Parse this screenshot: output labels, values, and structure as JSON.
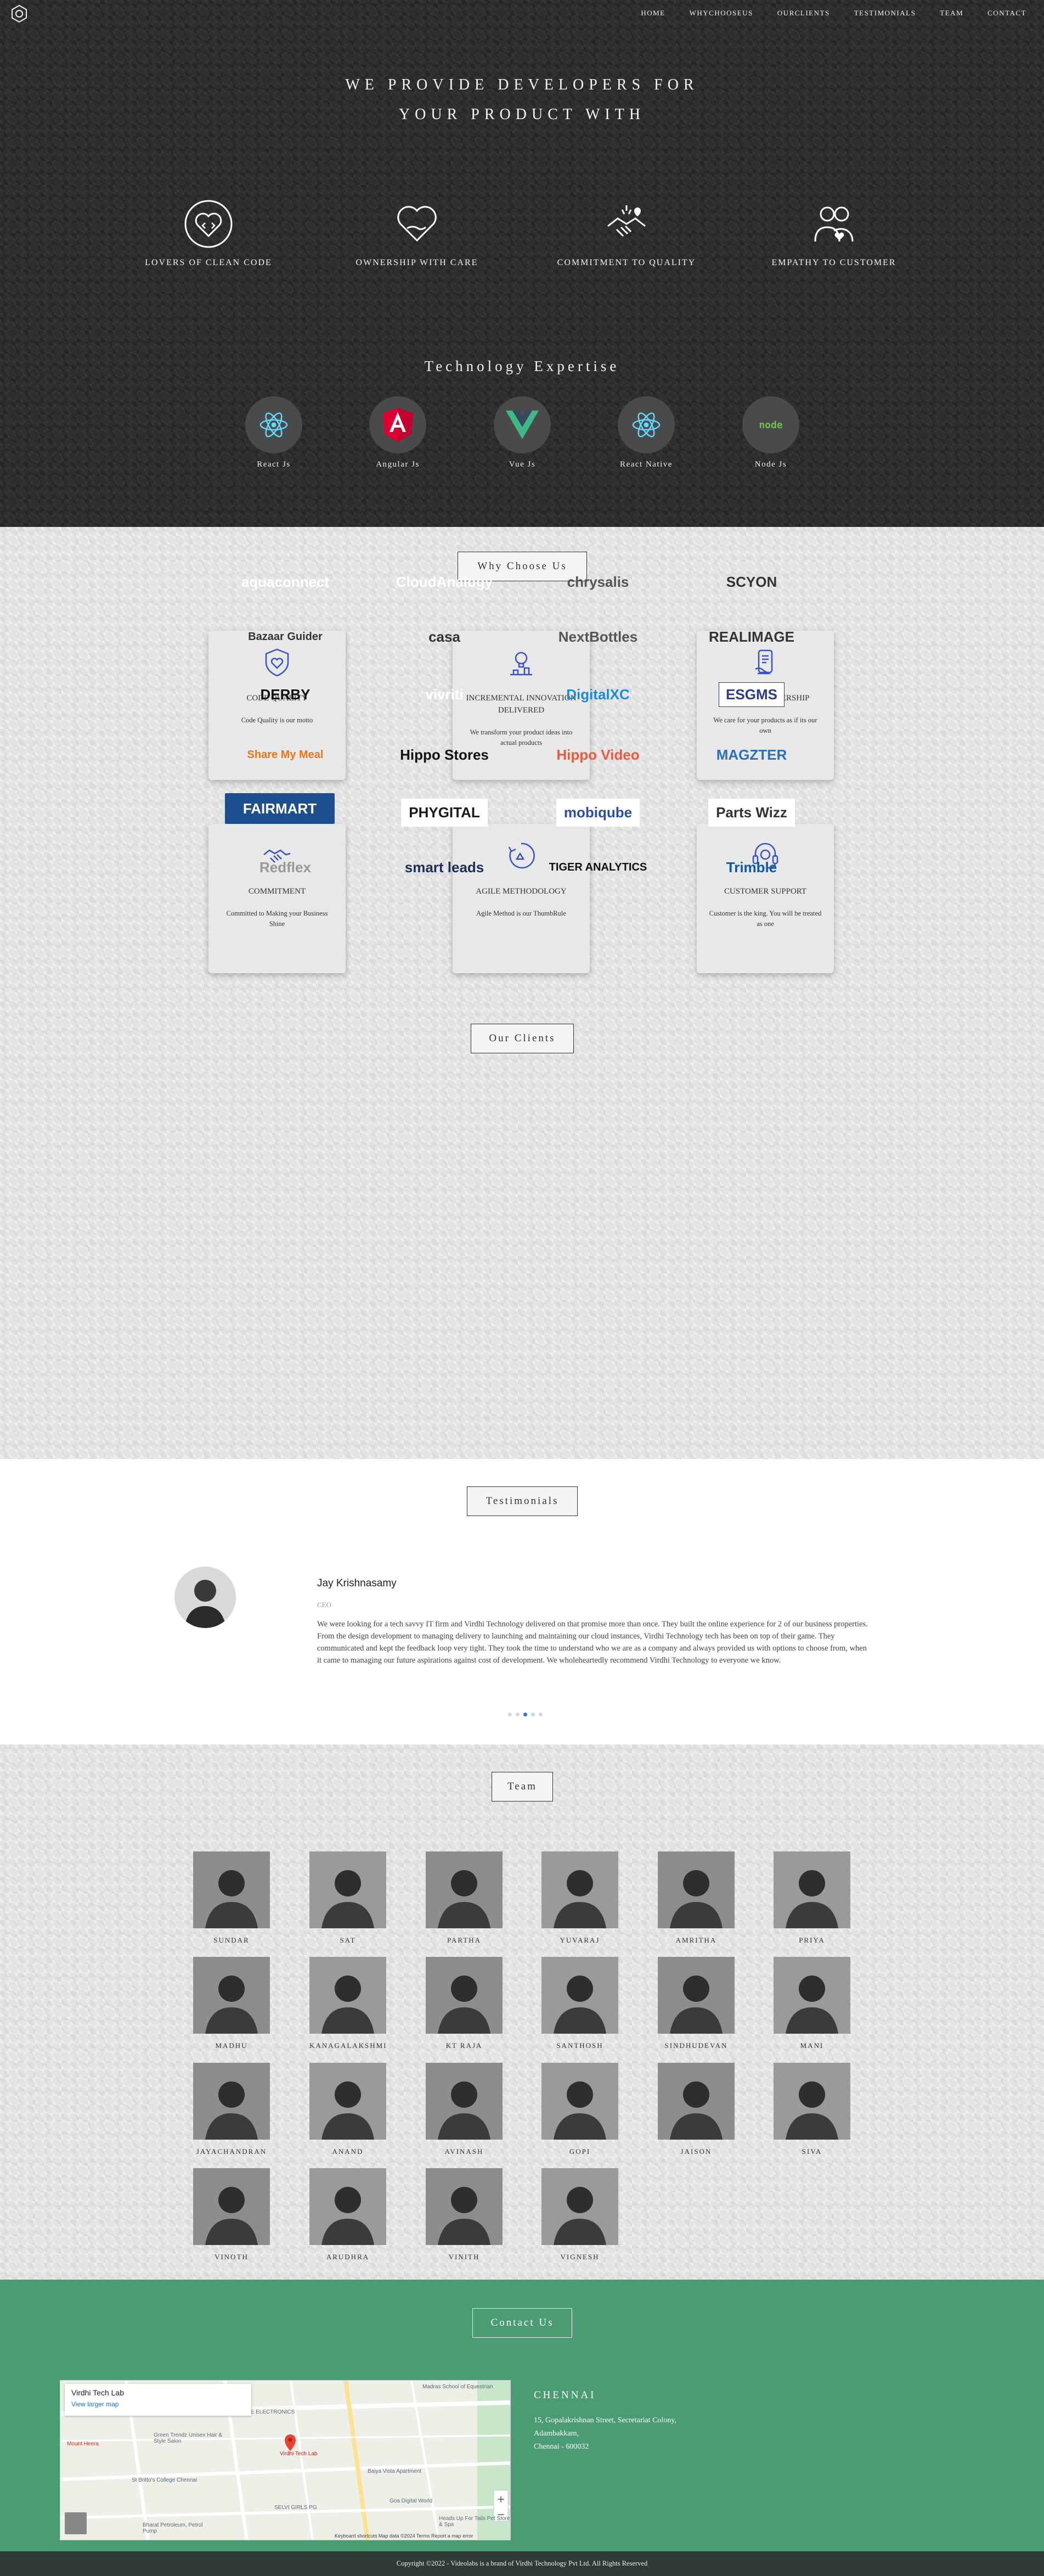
{
  "nav": {
    "items": [
      "HOME",
      "WHYCHOOSEUS",
      "OURCLIENTS",
      "TESTIMONIALS",
      "TEAM",
      "CONTACT"
    ]
  },
  "hero": {
    "title_line1": "WE PROVIDE DEVELOPERS FOR",
    "title_line2": "YOUR PRODUCT WITH",
    "values": [
      {
        "label": "LOVERS OF CLEAN CODE",
        "icon": "heart-code-icon"
      },
      {
        "label": "OWNERSHIP WITH CARE",
        "icon": "heart-hand-icon"
      },
      {
        "label": "COMMITMENT TO QUALITY",
        "icon": "handshake-icon"
      },
      {
        "label": "EMPATHY TO CUSTOMER",
        "icon": "people-heart-icon"
      }
    ],
    "tech_title": "Technology Expertise",
    "tech": [
      {
        "label": "React Js",
        "icon": "react-icon"
      },
      {
        "label": "Angular Js",
        "icon": "angular-icon"
      },
      {
        "label": "Vue Js",
        "icon": "vue-icon"
      },
      {
        "label": "React Native",
        "icon": "react-icon"
      },
      {
        "label": "Node Js",
        "icon": "node-icon"
      }
    ]
  },
  "why": {
    "heading": "Why Choose Us",
    "cards": [
      {
        "title": "CODE QUALITY",
        "desc": "Code Quality is our motto",
        "icon": "shield-heart-icon"
      },
      {
        "title": "INCREMENTAL INNOVATION DELIVERED",
        "desc": "We transform your product ideas into actual products",
        "icon": "innovation-icon"
      },
      {
        "title": "PRODUCT OWNERSHIP",
        "desc": "We care for your products as if its our own",
        "icon": "ownership-icon"
      },
      {
        "title": "COMMITMENT",
        "desc": "Committed to Making your Business Shine",
        "icon": "handshake-icon"
      },
      {
        "title": "AGILE METHODOLOGY",
        "desc": "Agile Method is our ThumbRule",
        "icon": "agile-icon"
      },
      {
        "title": "CUSTOMER SUPPORT",
        "desc": "Customer is the king. You will be treated as one",
        "icon": "headset-icon"
      }
    ]
  },
  "clients": {
    "heading": "Our Clients",
    "logos": [
      {
        "name": "aquaconnect",
        "color": "#ffffff"
      },
      {
        "name": "CloudAnalogy",
        "color": "#ffffff"
      },
      {
        "name": "chrysalis",
        "color": "#555555"
      },
      {
        "name": "SCYON",
        "color": "#333333"
      },
      {
        "name": "Bazaar Guider",
        "color": "#333333"
      },
      {
        "name": "casa",
        "color": "#333333"
      },
      {
        "name": "NextBottles",
        "color": "#555555"
      },
      {
        "name": "REALIMAGE",
        "color": "#333333"
      },
      {
        "name": "DERBY",
        "color": "#111111"
      },
      {
        "name": "vivriti",
        "color": "#ffffff"
      },
      {
        "name": "DigitalXC",
        "color": "#1a8dd8"
      },
      {
        "name": "ESGMS",
        "color": "#2a3a8f"
      },
      {
        "name": "Share My Meal",
        "color": "#e8761b"
      },
      {
        "name": "Hippo Stores",
        "color": "#111111"
      },
      {
        "name": "Hippo Video",
        "color": "#ea5a3d"
      },
      {
        "name": "MAGZTER",
        "color": "#2a70b8"
      },
      {
        "name": "FAIRMART",
        "color": "#ffffff"
      },
      {
        "name": "PHYGITAL",
        "color": "#1a1a1a"
      },
      {
        "name": "mobiqube",
        "color": "#2a4ea8"
      },
      {
        "name": "Parts Wizz",
        "color": "#333333"
      },
      {
        "name": "Redflex",
        "color": "#999999"
      },
      {
        "name": "smart leads",
        "color": "#1d2e55"
      },
      {
        "name": "TIGER ANALYTICS",
        "color": "#111111"
      },
      {
        "name": "Trimble",
        "color": "#0f5aa6"
      }
    ]
  },
  "testimonials": {
    "heading": "Testimonials",
    "name": "Jay Krishnasamy",
    "role": "CEO",
    "text": "We were looking for a tech savvy IT firm and Virdhi Technology delivered on that promise more than once. They built the online experience for 2 of our business properties. From the design development to managing delivery to launching and maintaining our cloud instances, Virdhi Technology tech has been on top of their game. They communicated and kept the feedback loop very tight. They took the time to understand who we are as a company and always provided us with options to choose from, when it came to managing our future aspirations against cost of development. We wholeheartedly recommend Virdhi Technology to everyone we know."
  },
  "team": {
    "heading": "Team",
    "members": [
      "SUNDAR",
      "SAT",
      "PARTHA",
      "YUVARAJ",
      "AMRITHA",
      "PRIYA",
      "MADHU",
      "KANAGALAKSHMI",
      "KT RAJA",
      "SANTHOSH",
      "SINDHUDEVAN",
      "MANI",
      "JAYACHANDRAN",
      "ANAND",
      "AVINASH",
      "GOPI",
      "JAISON",
      "SIVA",
      "VINOTH",
      "ARUDHRA",
      "VINITH",
      "VIGNESH"
    ]
  },
  "contact": {
    "heading": "Contact Us",
    "map_title": "Virdhi Tech Lab",
    "map_link": "View larger map",
    "map_labels": [
      "EAGLE ELECTRONICS",
      "Madras School of Equestrian",
      "Mount Heera",
      "Virdhi Tech Lab",
      "St Britto's College Chennai",
      "Baiya Vista Apartment",
      "Goa Digital World",
      "SELVI GIRLS PG",
      "Bharat Petroleum, Petrol Pump",
      "Heads Up For Tails Pet Store & Spa",
      "Green Trendz Unisex Hair & Style Salon"
    ],
    "map_footer": "Keyboard shortcuts   Map data ©2024   Terms   Report a map error",
    "city": "CHENNAI",
    "address": [
      "15, Gopalakrishnan Street, Secretariat Colony,",
      "Adambakkam,",
      "Chennai - 600032"
    ]
  },
  "footer": {
    "text": "Copyright ©2022 - Videolabs is a brand of Virdhi Technology Pvt Ltd. All Rights Reserved"
  },
  "colors": {
    "hero_bg": "#2e2e2e",
    "contact_bg": "#4a9c72",
    "icon_blue": "#3553c7",
    "active_dot": "#3f6ad8"
  }
}
